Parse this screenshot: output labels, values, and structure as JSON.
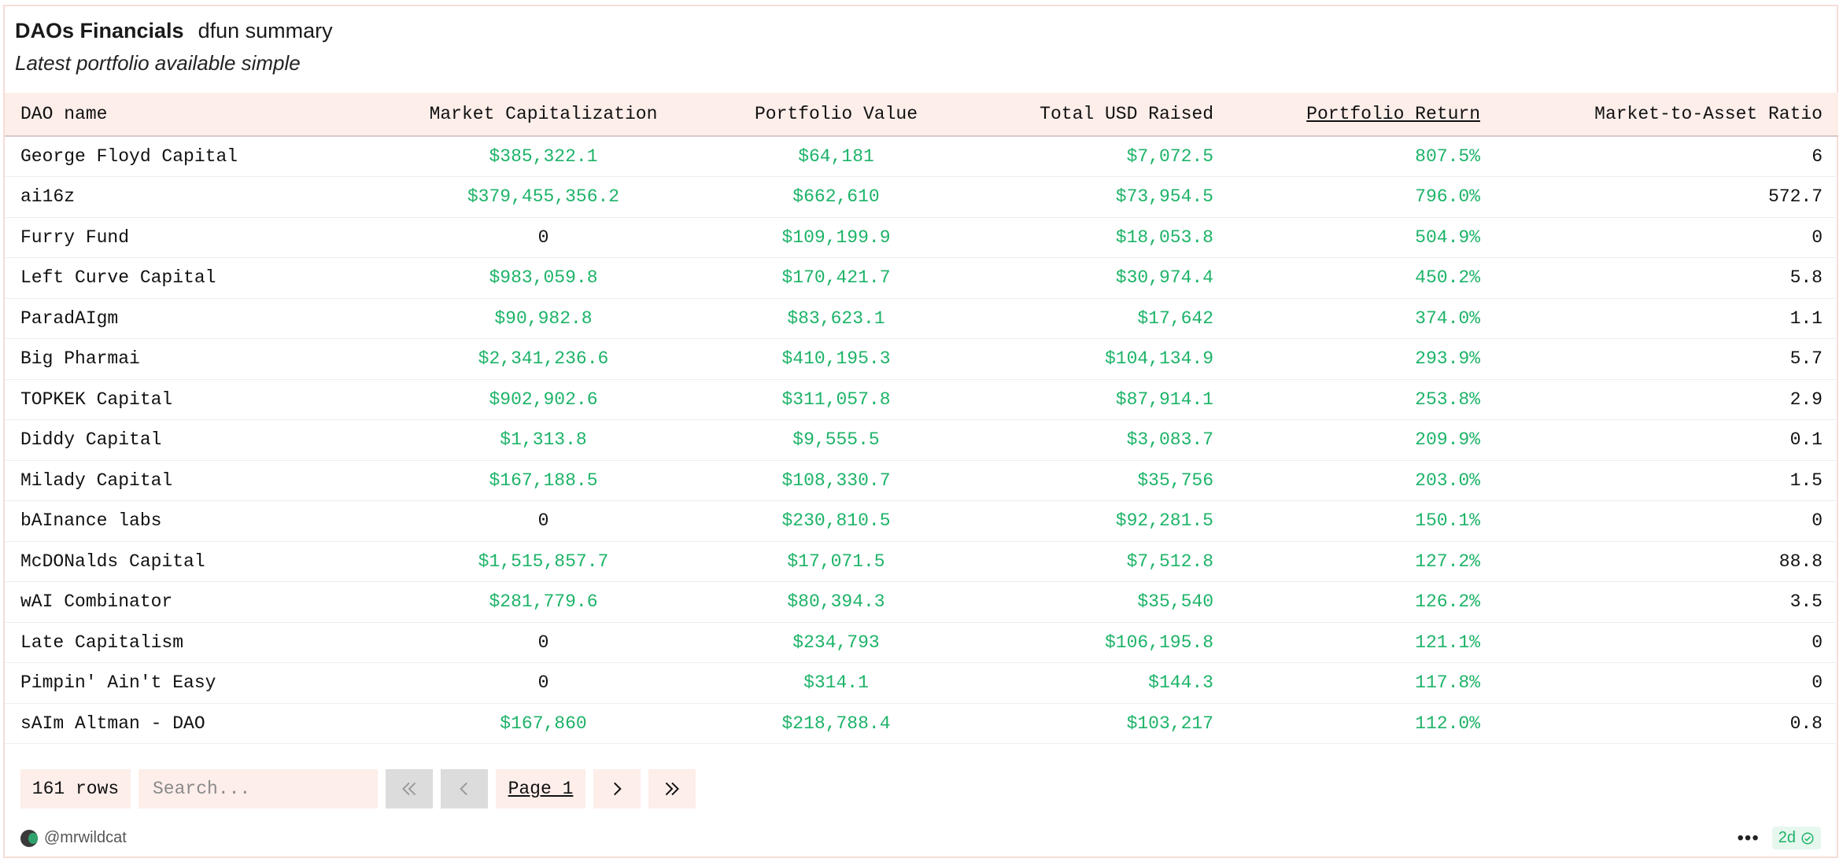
{
  "header": {
    "title": "DAOs Financials",
    "tag": "dfun summary",
    "description": "Latest portfolio available simple"
  },
  "table": {
    "columns": [
      "DAO name",
      "Market Capitalization",
      "Portfolio Value",
      "Total USD Raised",
      "Portfolio Return",
      "Market-to-Asset Ratio"
    ],
    "sorted_column": "Portfolio Return",
    "rows": [
      {
        "name": "George Floyd Capital",
        "mcap": "$385,322.1",
        "pv": "$64,181",
        "usd": "$7,072.5",
        "ret": "807.5%",
        "ratio": "6"
      },
      {
        "name": "ai16z",
        "mcap": "$379,455,356.2",
        "pv": "$662,610",
        "usd": "$73,954.5",
        "ret": "796.0%",
        "ratio": "572.7"
      },
      {
        "name": "Furry Fund",
        "mcap": "0",
        "pv": "$109,199.9",
        "usd": "$18,053.8",
        "ret": "504.9%",
        "ratio": "0"
      },
      {
        "name": "Left Curve Capital",
        "mcap": "$983,059.8",
        "pv": "$170,421.7",
        "usd": "$30,974.4",
        "ret": "450.2%",
        "ratio": "5.8"
      },
      {
        "name": "ParadAIgm",
        "mcap": "$90,982.8",
        "pv": "$83,623.1",
        "usd": "$17,642",
        "ret": "374.0%",
        "ratio": "1.1"
      },
      {
        "name": "Big Pharmai",
        "mcap": "$2,341,236.6",
        "pv": "$410,195.3",
        "usd": "$104,134.9",
        "ret": "293.9%",
        "ratio": "5.7"
      },
      {
        "name": "TOPKEK Capital",
        "mcap": "$902,902.6",
        "pv": "$311,057.8",
        "usd": "$87,914.1",
        "ret": "253.8%",
        "ratio": "2.9"
      },
      {
        "name": "Diddy Capital",
        "mcap": "$1,313.8",
        "pv": "$9,555.5",
        "usd": "$3,083.7",
        "ret": "209.9%",
        "ratio": "0.1"
      },
      {
        "name": "Milady Capital",
        "mcap": "$167,188.5",
        "pv": "$108,330.7",
        "usd": "$35,756",
        "ret": "203.0%",
        "ratio": "1.5"
      },
      {
        "name": "bAInance labs",
        "mcap": "0",
        "pv": "$230,810.5",
        "usd": "$92,281.5",
        "ret": "150.1%",
        "ratio": "0"
      },
      {
        "name": "McDONalds Capital",
        "mcap": "$1,515,857.7",
        "pv": "$17,071.5",
        "usd": "$7,512.8",
        "ret": "127.2%",
        "ratio": "88.8"
      },
      {
        "name": "wAI Combinator",
        "mcap": "$281,779.6",
        "pv": "$80,394.3",
        "usd": "$35,540",
        "ret": "126.2%",
        "ratio": "3.5"
      },
      {
        "name": "Late Capitalism",
        "mcap": "0",
        "pv": "$234,793",
        "usd": "$106,195.8",
        "ret": "121.1%",
        "ratio": "0"
      },
      {
        "name": "Pimpin' Ain't Easy",
        "mcap": "0",
        "pv": "$314.1",
        "usd": "$144.3",
        "ret": "117.8%",
        "ratio": "0"
      },
      {
        "name": "sAIm Altman - DAO",
        "mcap": "$167,860",
        "pv": "$218,788.4",
        "usd": "$103,217",
        "ret": "112.0%",
        "ratio": "0.8"
      }
    ]
  },
  "pager": {
    "rows_label": "161 rows",
    "search_placeholder": "Search...",
    "page_label": "Page 1",
    "first_icon": "double-chevron-left-icon",
    "prev_icon": "chevron-left-icon",
    "next_icon": "chevron-right-icon",
    "last_icon": "double-chevron-right-icon"
  },
  "footer": {
    "author": "@mrwildcat",
    "age": "2d",
    "more_icon": "ellipsis-icon",
    "check_icon": "check-circle-icon"
  },
  "colors": {
    "positive": "#1db368",
    "header_bg": "#fdeeea",
    "border": "#f6ddd8"
  }
}
